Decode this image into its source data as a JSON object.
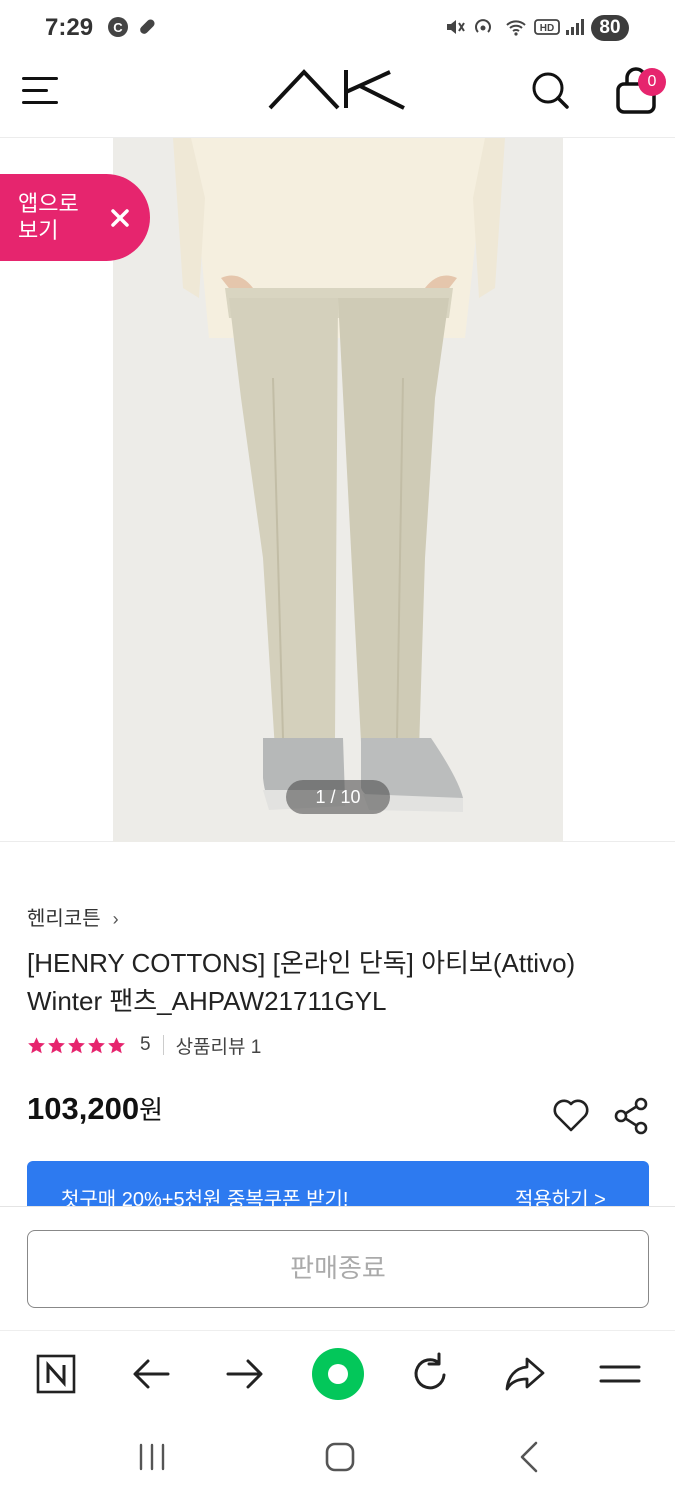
{
  "status_bar": {
    "time": "7:29",
    "battery": "80"
  },
  "header": {
    "logo_text": "AK",
    "cart_count": "0"
  },
  "app_banner": {
    "label": "앱으로 보기"
  },
  "gallery": {
    "counter": "1 / 10"
  },
  "product": {
    "brand": "헨리코튼",
    "title": "[HENRY COTTONS] [온라인 단독] 아티보(Attivo) Winter 팬츠_AHPAW21711GYL",
    "rating_score": "5",
    "review_label": "상품리뷰 1",
    "price_number": "103,200",
    "price_unit": "원",
    "star_color": "#e6256e",
    "stars": 5
  },
  "coupon": {
    "text": "첫구매 20%+5천원 중복쿠폰 받기!",
    "apply_label": "적용하기 >",
    "color": "#2d7af0"
  },
  "action": {
    "soldout_label": "판매종료"
  },
  "browser_toolbar": {
    "items": [
      "naver-icon",
      "back-arrow-icon",
      "forward-arrow-icon",
      "home-circle-icon",
      "reload-icon",
      "share-arrow-icon",
      "menu-icon"
    ],
    "accent": "#03c75a"
  },
  "system_nav": {
    "items": [
      "recents-icon",
      "home-icon",
      "back-icon"
    ]
  },
  "colors": {
    "brand_pink": "#e6256e"
  }
}
